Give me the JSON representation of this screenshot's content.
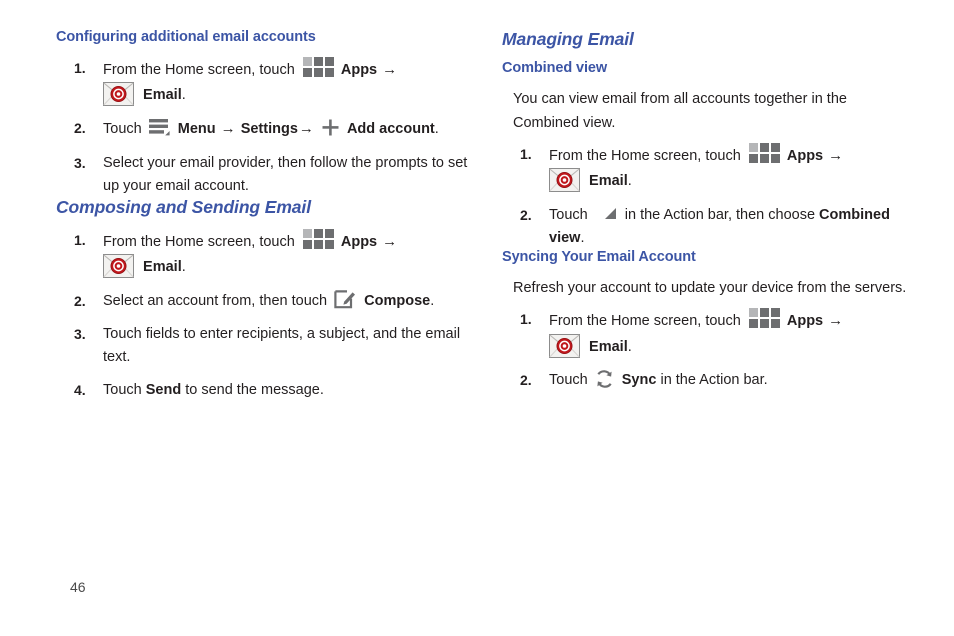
{
  "page": {
    "number": "46",
    "heading_color": "#3c55a5",
    "text_color": "#231f20",
    "icon_gray": "#6d6e70",
    "icon_red": "#cc2127"
  },
  "icons": {
    "apps": "apps-grid-icon",
    "email": "email-envelope-icon",
    "menu": "menu-icon",
    "plus": "plus-icon",
    "compose": "compose-icon",
    "sync": "sync-icon",
    "triangle": "action-bar-triangle-icon",
    "arrow": "→"
  },
  "left_column": {
    "section1": {
      "heading": "Configuring additional email accounts",
      "steps": [
        {
          "num": "1.",
          "line1_pre": "From the Home screen, touch",
          "apps_label": "Apps",
          "line2_email_label": "Email",
          "line2_period": "."
        },
        {
          "num": "2.",
          "pre": "Touch",
          "menu_label": "Menu",
          "settings_label": "Settings",
          "add_account_label": "Add account",
          "period": "."
        },
        {
          "num": "3.",
          "text": "Select your email provider, then follow the prompts to set up your email account."
        }
      ]
    },
    "section2": {
      "heading": "Composing and Sending Email",
      "steps": [
        {
          "num": "1.",
          "line1_pre": "From the Home screen, touch",
          "apps_label": "Apps",
          "line2_email_label": "Email",
          "line2_period": "."
        },
        {
          "num": "2.",
          "pre": "Select an account from, then touch",
          "compose_label": "Compose",
          "period": "."
        },
        {
          "num": "3.",
          "text": "Touch fields to enter recipients, a subject, and the email text."
        },
        {
          "num": "4.",
          "pre": "Touch",
          "bold": "Send",
          "post": "to send the message."
        }
      ]
    }
  },
  "right_column": {
    "section_title": "Managing Email",
    "section1": {
      "heading": "Combined view",
      "paragraph": "You can view email from all accounts together in the Combined view.",
      "steps": [
        {
          "num": "1.",
          "line1_pre": "From the Home screen, touch",
          "apps_label": "Apps",
          "line2_email_label": "Email",
          "line2_period": "."
        },
        {
          "num": "2.",
          "pre": "Touch",
          "mid": "in the Action bar, then choose",
          "bold1": "Combined",
          "bold2": "view",
          "period": "."
        }
      ]
    },
    "section2": {
      "heading": "Syncing Your Email Account",
      "paragraph": "Refresh your account to update your device from the servers.",
      "steps": [
        {
          "num": "1.",
          "line1_pre": "From the Home screen, touch",
          "apps_label": "Apps",
          "line2_email_label": "Email",
          "line2_period": "."
        },
        {
          "num": "2.",
          "pre": "Touch",
          "bold": "Sync",
          "post": "in the Action bar."
        }
      ]
    }
  }
}
